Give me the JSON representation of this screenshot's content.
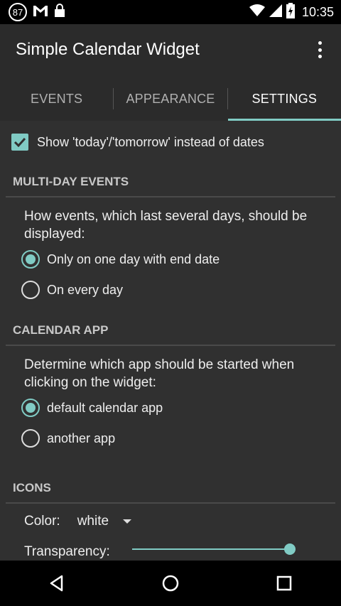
{
  "status_bar": {
    "notification_count": "87",
    "time": "10:35",
    "icons": [
      "gmail-icon",
      "lock-icon",
      "wifi-icon",
      "signal-icon",
      "battery-charging-icon"
    ]
  },
  "app": {
    "title": "Simple Calendar Widget",
    "menu_icon": "overflow-menu-icon"
  },
  "tabs": [
    {
      "label": "EVENTS",
      "active": false
    },
    {
      "label": "APPEARANCE",
      "active": false
    },
    {
      "label": "SETTINGS",
      "active": true
    }
  ],
  "settings": {
    "show_today_label": "Show 'today'/'tomorrow' instead of dates",
    "show_today_checked": true,
    "multi_day": {
      "title": "MULTI-DAY EVENTS",
      "description": "How events, which last several days, should be displayed:",
      "options": [
        {
          "label": "Only on one day with end date",
          "selected": true
        },
        {
          "label": "On every day",
          "selected": false
        }
      ]
    },
    "calendar_app": {
      "title": "CALENDAR APP",
      "description": "Determine which app should be started when clicking on the widget:",
      "options": [
        {
          "label": "default calendar app",
          "selected": true
        },
        {
          "label": "another app",
          "selected": false
        }
      ]
    },
    "icons": {
      "title": "ICONS",
      "color_label": "Color:",
      "color_value": "white",
      "transparency_label": "Transparency:",
      "transparency_level": 1.0
    }
  },
  "accent_color": "#80cbc4"
}
